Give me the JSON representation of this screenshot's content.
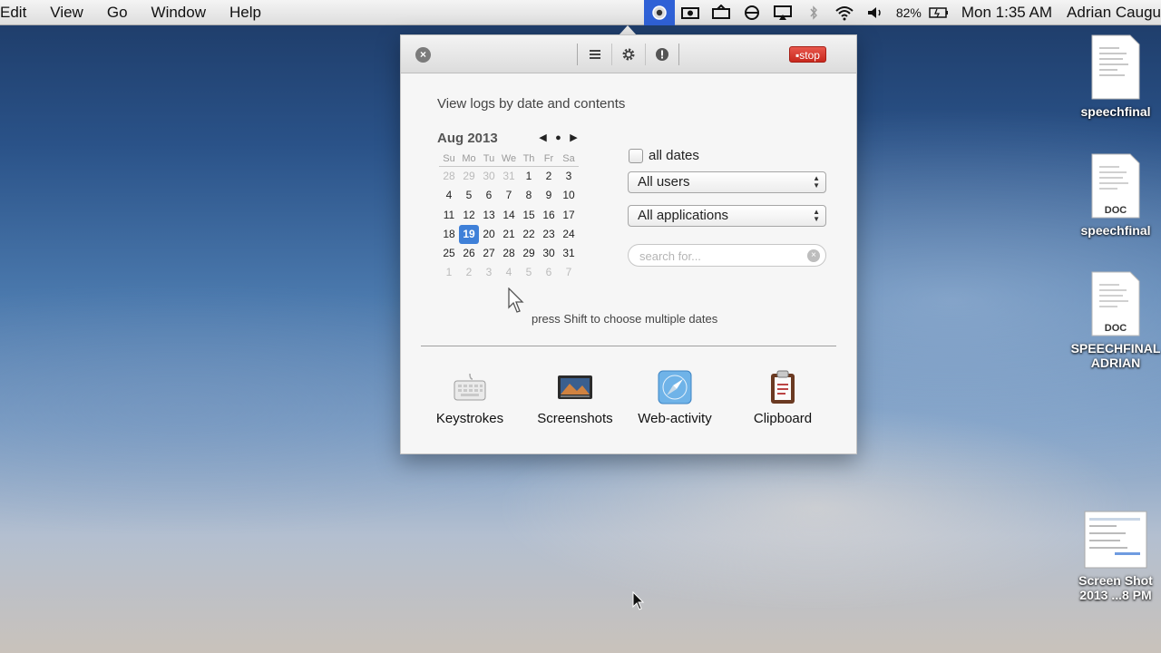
{
  "menubar": {
    "menus": [
      "Edit",
      "View",
      "Go",
      "Window",
      "Help"
    ],
    "battery": "82%",
    "clock": "Mon 1:35 AM",
    "user": "Adrian Caugu",
    "status_icons": [
      "spy-agent-icon",
      "video-icon",
      "screen-share-icon",
      "block-icon",
      "airplay-icon",
      "bluetooth-icon",
      "wifi-icon",
      "volume-icon",
      "battery-icon"
    ]
  },
  "panel": {
    "toolbar": {
      "buttons": [
        "list-icon",
        "gear-icon",
        "alert-icon"
      ],
      "stop_label": "stop"
    },
    "headline": "View logs by date and contents",
    "calendar": {
      "month_label": "Aug 2013",
      "weekdays": [
        "Su",
        "Mo",
        "Tu",
        "We",
        "Th",
        "Fr",
        "Sa"
      ],
      "selected_day": "19",
      "weeks": [
        [
          {
            "d": "28",
            "dim": true
          },
          {
            "d": "29",
            "dim": true
          },
          {
            "d": "30",
            "dim": true
          },
          {
            "d": "31",
            "dim": true
          },
          {
            "d": "1"
          },
          {
            "d": "2"
          },
          {
            "d": "3"
          }
        ],
        [
          {
            "d": "4"
          },
          {
            "d": "5"
          },
          {
            "d": "6"
          },
          {
            "d": "7"
          },
          {
            "d": "8"
          },
          {
            "d": "9"
          },
          {
            "d": "10"
          }
        ],
        [
          {
            "d": "11"
          },
          {
            "d": "12"
          },
          {
            "d": "13"
          },
          {
            "d": "14"
          },
          {
            "d": "15"
          },
          {
            "d": "16"
          },
          {
            "d": "17"
          }
        ],
        [
          {
            "d": "18"
          },
          {
            "d": "19"
          },
          {
            "d": "20"
          },
          {
            "d": "21"
          },
          {
            "d": "22"
          },
          {
            "d": "23"
          },
          {
            "d": "24"
          }
        ],
        [
          {
            "d": "25"
          },
          {
            "d": "26"
          },
          {
            "d": "27"
          },
          {
            "d": "28"
          },
          {
            "d": "29"
          },
          {
            "d": "30"
          },
          {
            "d": "31"
          }
        ],
        [
          {
            "d": "1",
            "dim": true
          },
          {
            "d": "2",
            "dim": true
          },
          {
            "d": "3",
            "dim": true
          },
          {
            "d": "4",
            "dim": true
          },
          {
            "d": "5",
            "dim": true
          },
          {
            "d": "6",
            "dim": true
          },
          {
            "d": "7",
            "dim": true
          }
        ]
      ],
      "hint": "press Shift to choose multiple dates"
    },
    "filters": {
      "all_dates_label": "all dates",
      "users_select": "All users",
      "apps_select": "All applications",
      "search_placeholder": "search for..."
    },
    "tools": [
      {
        "label": "Keystrokes",
        "icon": "keyboard-icon"
      },
      {
        "label": "Screenshots",
        "icon": "screenshot-icon"
      },
      {
        "label": "Web-activity",
        "icon": "safari-icon"
      },
      {
        "label": "Clipboard",
        "icon": "clipboard-icon"
      }
    ]
  },
  "desktop": {
    "icons": [
      {
        "label": "speechfinal",
        "badge": ""
      },
      {
        "label": "speechfinal",
        "badge": "DOC"
      },
      {
        "label": "SPEECHFINAL ADRIAN",
        "badge": "DOC"
      },
      {
        "label": "Screen Shot 2013 ...8 PM",
        "badge": ""
      }
    ]
  },
  "colors": {
    "accent": "#3f80d8",
    "stop_red": "#c8281d",
    "menubar_active": "#2f61d6"
  }
}
